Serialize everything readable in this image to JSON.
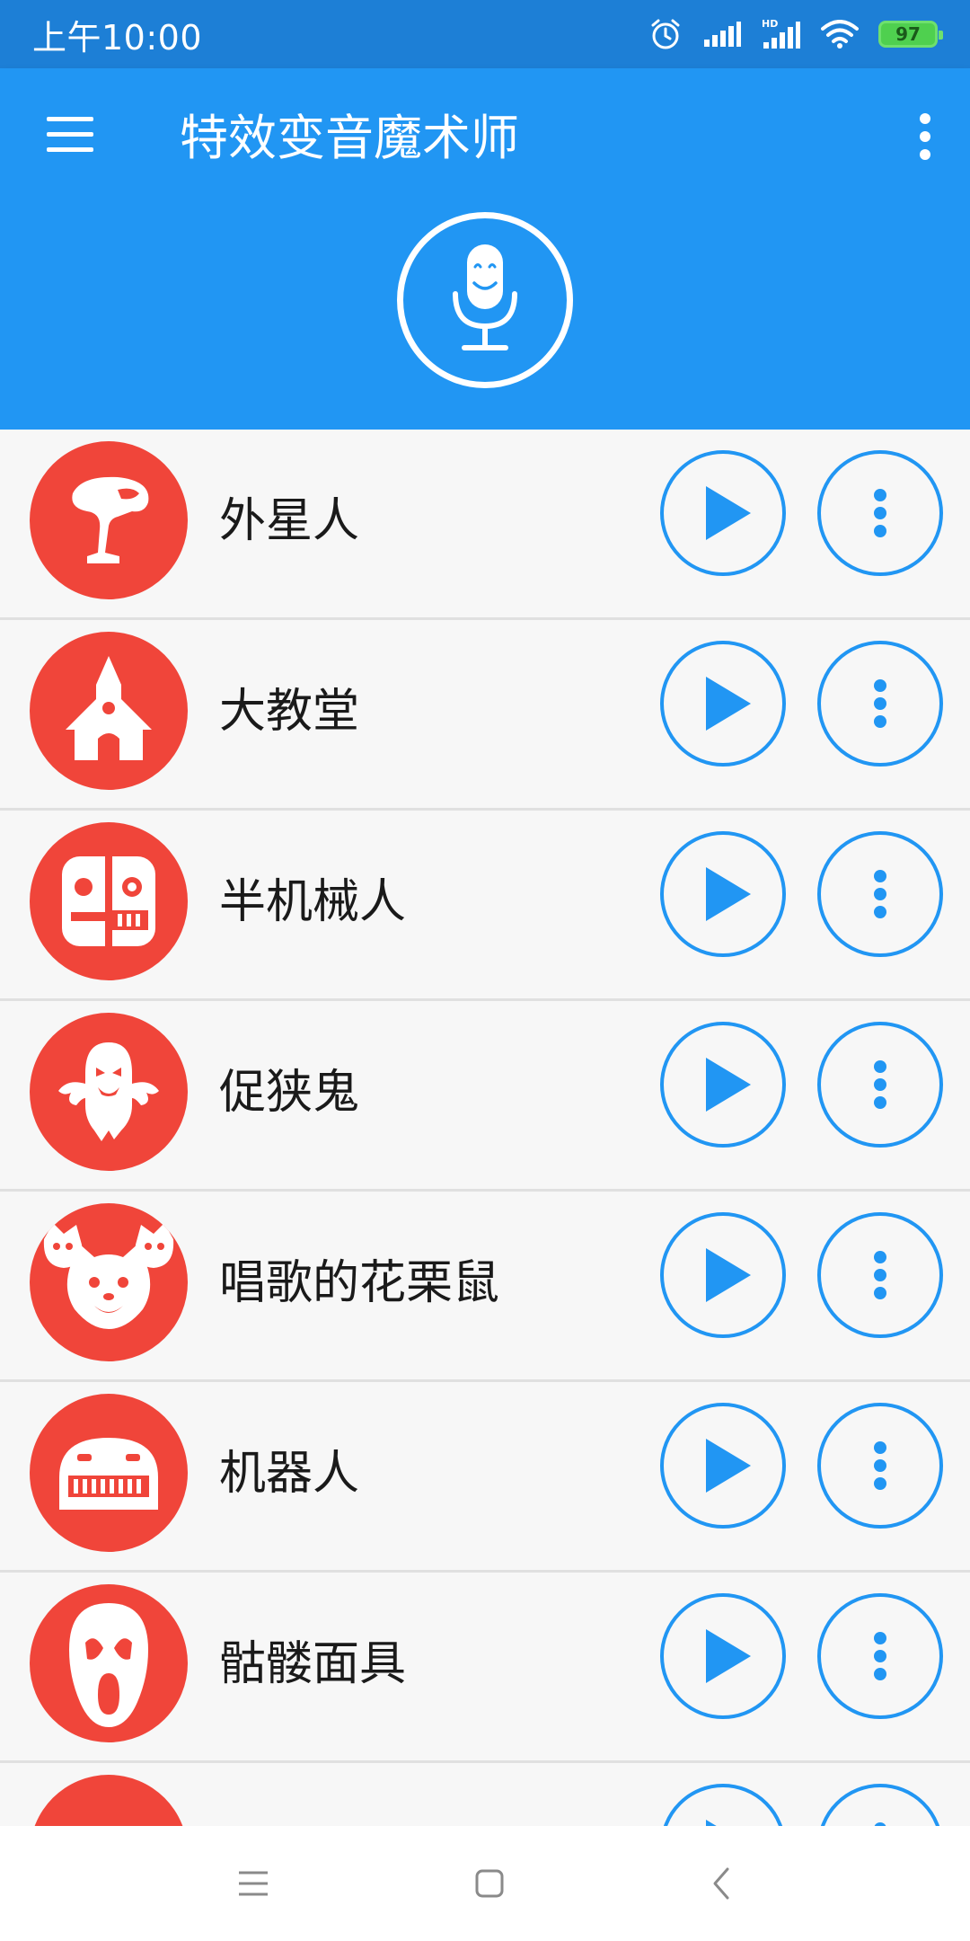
{
  "status_bar": {
    "time": "上午10:00",
    "battery": "97",
    "network_label": "HD",
    "icons": [
      "alarm-icon",
      "signal-icon",
      "signal-hd-icon",
      "wifi-icon",
      "battery-icon"
    ]
  },
  "app_bar": {
    "title": "特效变音魔术师",
    "menu_icon": "hamburger-menu-icon",
    "more_icon": "more-vertical-icon",
    "record_icon": "microphone-icon"
  },
  "effects": [
    {
      "label": "外星人",
      "icon": "alien-icon"
    },
    {
      "label": "大教堂",
      "icon": "cathedral-icon"
    },
    {
      "label": "半机械人",
      "icon": "cyborg-icon"
    },
    {
      "label": "促狭鬼",
      "icon": "ghost-icon"
    },
    {
      "label": "唱歌的花栗鼠",
      "icon": "chipmunks-icon"
    },
    {
      "label": "机器人",
      "icon": "robot-icon"
    },
    {
      "label": "骷髅面具",
      "icon": "scream-mask-icon"
    },
    {
      "label": "",
      "icon": "partial-icon"
    }
  ],
  "colors": {
    "status_bar": "#1d7fd6",
    "app_bar": "#2196f3",
    "effect_icon_bg": "#f0453a",
    "accent": "#2196f3"
  },
  "nav_bar": {
    "icons": [
      "recent-apps-icon",
      "home-icon",
      "back-icon"
    ]
  }
}
